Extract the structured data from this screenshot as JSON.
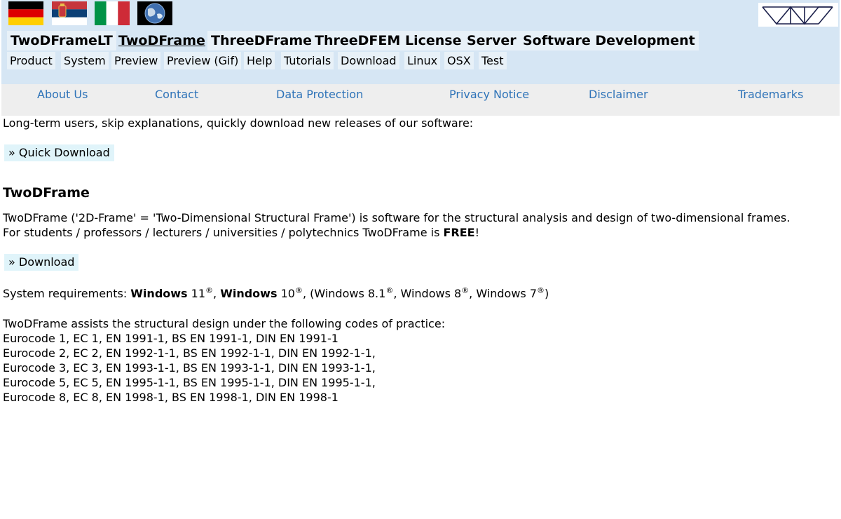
{
  "header": {
    "flags": [
      {
        "name": "german-flag"
      },
      {
        "name": "serbian-flag"
      },
      {
        "name": "italian-flag"
      },
      {
        "name": "globe"
      }
    ],
    "main_nav": [
      "TwoDFrameLT",
      "TwoDFrame",
      "ThreeDFrame",
      "ThreeDFEM",
      "License",
      "Server",
      "Software Development"
    ],
    "active_main": "TwoDFrame",
    "sub_nav": [
      "Product",
      "System",
      "Preview",
      "Preview (Gif)",
      "Help",
      "Tutorials",
      "Download",
      "Linux",
      "OSX",
      "Test"
    ]
  },
  "footer_links": [
    "About Us",
    "Contact",
    "Data Protection",
    "Privacy Notice",
    "Disclaimer",
    "Trademarks"
  ],
  "content": {
    "intro": "Long-term users, skip explanations, quickly download new releases of our software:",
    "quick_download": "» Quick Download",
    "title": "TwoDFrame",
    "desc_line1": "TwoDFrame ('2D-Frame' = 'Two-Dimensional Structural Frame') is software for the structural analysis and design of two-dimensional frames.",
    "desc_line2_prefix": "For students / professors / lecturers / universities / polytechnics TwoDFrame is ",
    "desc_line2_bold": "FREE",
    "desc_line2_suffix": "!",
    "download": "» Download",
    "sysreq_label": "System requirements: ",
    "win_bold": "Windows",
    "win11": " 11",
    "win10": " 10",
    "reg": "®",
    "sep": ", ",
    "sysreq_rest_open": ", (Windows 8.1",
    "sysreq_w8": ", Windows 8",
    "sysreq_w7": ", Windows 7",
    "sysreq_close": ")",
    "codes_intro": "TwoDFrame assists the structural design under the following codes of practice:",
    "codes": [
      "Eurocode 1, EC 1, EN 1991-1, BS EN 1991-1, DIN EN 1991-1",
      "Eurocode 2, EC 2, EN 1992-1-1, BS EN 1992-1-1, DIN EN 1992-1-1,",
      "Eurocode 3, EC 3, EN 1993-1-1, BS EN 1993-1-1, DIN EN 1993-1-1,",
      "Eurocode 5, EC 5, EN 1995-1-1, BS EN 1995-1-1, DIN EN 1995-1-1,",
      "Eurocode 8, EC 8, EN 1998-1, BS EN 1998-1, DIN EN 1998-1"
    ]
  },
  "colors": {
    "header_bg": "#d6e6f4",
    "footer_bg": "#eeeeee",
    "link": "#2e73b8",
    "button_bg": "#e0f4fa"
  }
}
